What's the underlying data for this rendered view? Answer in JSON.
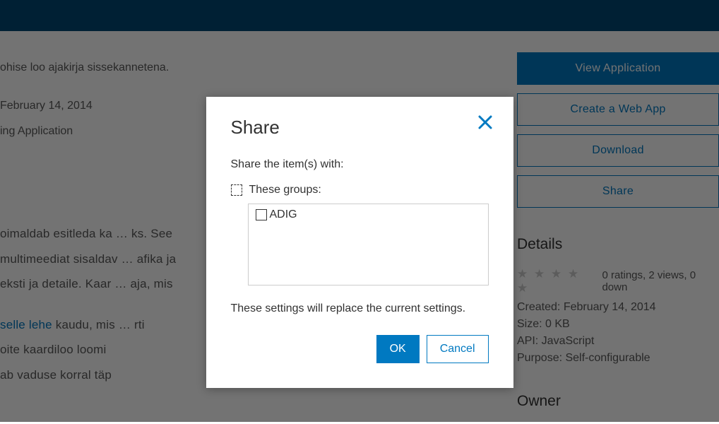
{
  "background": {
    "intro": "ohise loo ajakirja sissekannetena.",
    "date_line": "February 14, 2014",
    "type_line": "ing Application",
    "desc": {
      "p1_prefix": "oimaldab esitleda ka",
      "p1_suffix": "ks. See",
      "p2_prefix": "multimeediat sisaldav",
      "p2_suffix": "afika ja",
      "p3_prefix": "eksti ja detaile. Kaar",
      "p3_suffix": "aja, mis",
      "p4_link": "selle lehe",
      "p4_mid": " kaudu, mis",
      "p4_suffix": "rti",
      "p5_prefix": "oite kaardiloo loomi",
      "p6_prefix": "ab vaduse korral täp"
    }
  },
  "actions": {
    "view_app": "View Application",
    "create_web_app": "Create a Web App",
    "download": "Download",
    "share": "Share"
  },
  "details": {
    "heading": "Details",
    "ratings_text": "0 ratings, 2 views, 0 down",
    "created": "Created: February 14, 2014",
    "size": "Size: 0 KB",
    "api": "API: JavaScript",
    "purpose": "Purpose: Self-configurable"
  },
  "owner": {
    "heading": "Owner"
  },
  "modal": {
    "title": "Share",
    "subtitle": "Share the item(s) with:",
    "groups_label": "These groups:",
    "group_name": "ADIG",
    "note": "These settings will replace the current settings.",
    "ok": "OK",
    "cancel": "Cancel"
  }
}
